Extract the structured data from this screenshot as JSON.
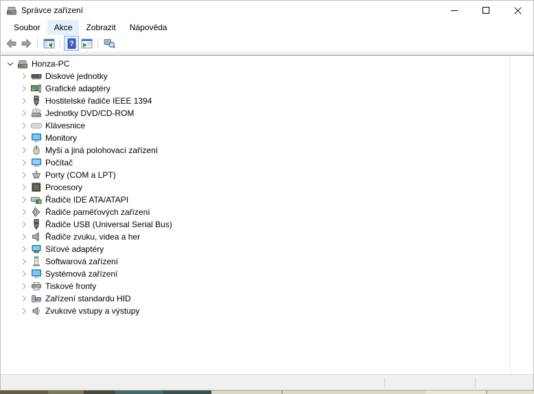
{
  "window": {
    "title": "Správce zařízení",
    "app_icon": "device-manager-icon",
    "controls": [
      {
        "name": "minimize-button",
        "icon": "minimize-icon"
      },
      {
        "name": "maximize-button",
        "icon": "maximize-icon"
      },
      {
        "name": "close-button",
        "icon": "close-icon"
      }
    ]
  },
  "menu_bar": {
    "items": [
      {
        "name": "menu-soubor",
        "label": "Soubor",
        "highlighted": false
      },
      {
        "name": "menu-akce",
        "label": "Akce",
        "highlighted": true
      },
      {
        "name": "menu-zobrazit",
        "label": "Zobrazit",
        "highlighted": false
      },
      {
        "name": "menu-napoveda",
        "label": "Nápověda",
        "highlighted": false
      }
    ]
  },
  "toolbar": {
    "buttons": [
      {
        "name": "back-button",
        "icon": "arrow-left-icon",
        "enabled": false
      },
      {
        "name": "forward-button",
        "icon": "arrow-right-icon",
        "enabled": false
      },
      {
        "name": "separator"
      },
      {
        "name": "console-tree-button",
        "icon": "console-tree-icon",
        "enabled": true
      },
      {
        "name": "separator"
      },
      {
        "name": "help-button",
        "icon": "help-icon",
        "enabled": true,
        "highlighted": true
      },
      {
        "name": "properties-button",
        "icon": "properties-icon",
        "enabled": true
      },
      {
        "name": "separator"
      },
      {
        "name": "scan-hardware-button",
        "icon": "scan-hardware-icon",
        "enabled": true
      }
    ]
  },
  "tree": {
    "items": [
      {
        "name": "honza-pc",
        "label": "Honza-PC",
        "icon": "computer-icon",
        "depth": 0,
        "expanded": true
      },
      {
        "name": "diskove-jednotky",
        "label": "Diskové jednotky",
        "icon": "disk-drive-icon",
        "depth": 1,
        "expanded": false
      },
      {
        "name": "graficke-adaptery",
        "label": "Grafické adaptéry",
        "icon": "graphics-card-icon",
        "depth": 1,
        "expanded": false
      },
      {
        "name": "hostitelske-radice-ieee-1394",
        "label": "Hostitelské řadiče IEEE 1394",
        "icon": "firewire-icon",
        "depth": 1,
        "expanded": false
      },
      {
        "name": "jednotky-dvd-cd-rom",
        "label": "Jednotky DVD/CD-ROM",
        "icon": "cd-drive-icon",
        "depth": 1,
        "expanded": false
      },
      {
        "name": "klavesnice",
        "label": "Klávesnice",
        "icon": "keyboard-icon",
        "depth": 1,
        "expanded": false
      },
      {
        "name": "monitory",
        "label": "Monitory",
        "icon": "monitor-icon",
        "depth": 1,
        "expanded": false
      },
      {
        "name": "mysi-a-jina-polohovaci-zarizeni",
        "label": "Myši a jiná polohovací zařízení",
        "icon": "mouse-icon",
        "depth": 1,
        "expanded": false
      },
      {
        "name": "pocitac",
        "label": "Počítač",
        "icon": "computer-monitor-icon",
        "depth": 1,
        "expanded": false
      },
      {
        "name": "porty-com-a-lpt",
        "label": "Porty (COM a LPT)",
        "icon": "serial-port-icon",
        "depth": 1,
        "expanded": false
      },
      {
        "name": "procesory",
        "label": "Procesory",
        "icon": "processor-icon",
        "depth": 1,
        "expanded": false
      },
      {
        "name": "radice-ide-ata-atapi",
        "label": "Řadiče IDE ATA/ATAPI",
        "icon": "ide-controller-icon",
        "depth": 1,
        "expanded": false
      },
      {
        "name": "radice-pametovych-zarizeni",
        "label": "Řadiče paměťových zařízení",
        "icon": "storage-controller-icon",
        "depth": 1,
        "expanded": false
      },
      {
        "name": "radice-usb",
        "label": "Řadiče USB (Universal Serial Bus)",
        "icon": "usb-icon",
        "depth": 1,
        "expanded": false
      },
      {
        "name": "radice-zvuku-videa-a-her",
        "label": "Řadiče zvuku, videa a her",
        "icon": "speaker-icon",
        "depth": 1,
        "expanded": false
      },
      {
        "name": "sitove-adaptery",
        "label": "Síťové adaptéry",
        "icon": "network-adapter-icon",
        "depth": 1,
        "expanded": false
      },
      {
        "name": "softwarova-zarizeni",
        "label": "Softwarová zařízení",
        "icon": "software-device-icon",
        "depth": 1,
        "expanded": false
      },
      {
        "name": "systemova-zarizeni",
        "label": "Systémová zařízení",
        "icon": "system-device-icon",
        "depth": 1,
        "expanded": false
      },
      {
        "name": "tiskove-fronty",
        "label": "Tiskové fronty",
        "icon": "printer-icon",
        "depth": 1,
        "expanded": false
      },
      {
        "name": "zarizeni-standardu-hid",
        "label": "Zařízení standardu HID",
        "icon": "hid-device-icon",
        "depth": 1,
        "expanded": false
      },
      {
        "name": "zvukove-vstupy-a-vystupy",
        "label": "Zvukové vstupy a výstupy",
        "icon": "audio-io-icon",
        "depth": 1,
        "expanded": false
      }
    ]
  },
  "status_bar": {
    "panes": [
      "",
      "",
      ""
    ]
  },
  "colors": {
    "menu_highlight": "#e1f0fb",
    "toolbar_button_highlight": "#dcecf9",
    "toolbar_button_border": "#86b8e2",
    "tree_top_border": "#8a9099",
    "status_bar_bg": "#f0f0f0",
    "window_bottom_line": "#c9a852"
  }
}
